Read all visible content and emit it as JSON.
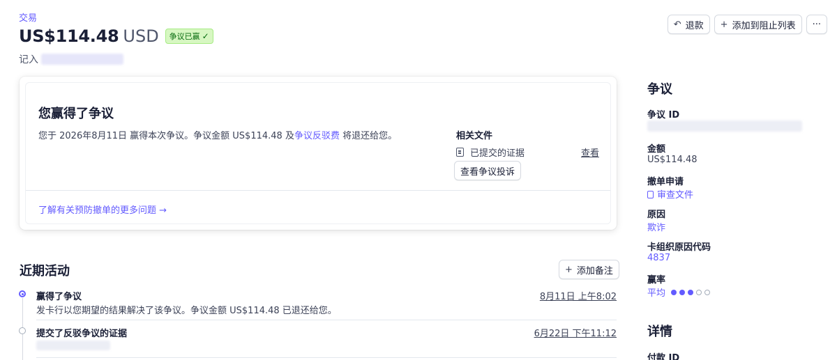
{
  "header": {
    "breadcrumb": "交易",
    "amount": "US$114.48",
    "currency": "USD",
    "status_badge": "争议已赢",
    "recorded_label": "记入"
  },
  "actions": {
    "refund": "退款",
    "add_blocklist": "添加到阻止列表",
    "more": "···"
  },
  "dispute_card": {
    "title": "您赢得了争议",
    "description_prefix": "您于 2026年8月11日 赢得本次争议。争议金额 US$114.48 及",
    "description_link": "争议反驳费",
    "description_suffix": " 将退还给您。",
    "related_files_title": "相关文件",
    "submitted_evidence": "已提交的证据",
    "view_link": "查看",
    "view_complaint_button": "查看争议投诉",
    "learn_more_link": "了解有关预防撤单的更多问题 →"
  },
  "recent_activity": {
    "title": "近期活动",
    "add_note_button": "添加备注",
    "items": [
      {
        "title": "赢得了争议",
        "description": "发卡行以您期望的结果解决了该争议。争议金额 US$114.48 已退还给您。",
        "time": "8月11日 上午8:02"
      },
      {
        "title": "提交了反驳争议的证据",
        "description": "",
        "time": "6月22日 下午11:12"
      }
    ]
  },
  "sidebar": {
    "dispute_heading": "争议",
    "dispute_id_label": "争议 ID",
    "amount_label": "金额",
    "amount_value": "US$114.48",
    "chargeback_label": "撤单申请",
    "chargeback_link": "审查文件",
    "reason_label": "原因",
    "reason_value": "欺诈",
    "reason_code_label": "卡组织原因代码",
    "reason_code_value": "4837",
    "win_rate_label": "赢率",
    "win_rate_value": "平均",
    "win_rate_level": 3,
    "win_rate_max": 5,
    "details_heading": "详情",
    "payment_id_label": "付款 ID"
  },
  "colors": {
    "accent": "#635bff",
    "badge_bg": "#d7f7c2",
    "badge_text": "#05690d"
  }
}
